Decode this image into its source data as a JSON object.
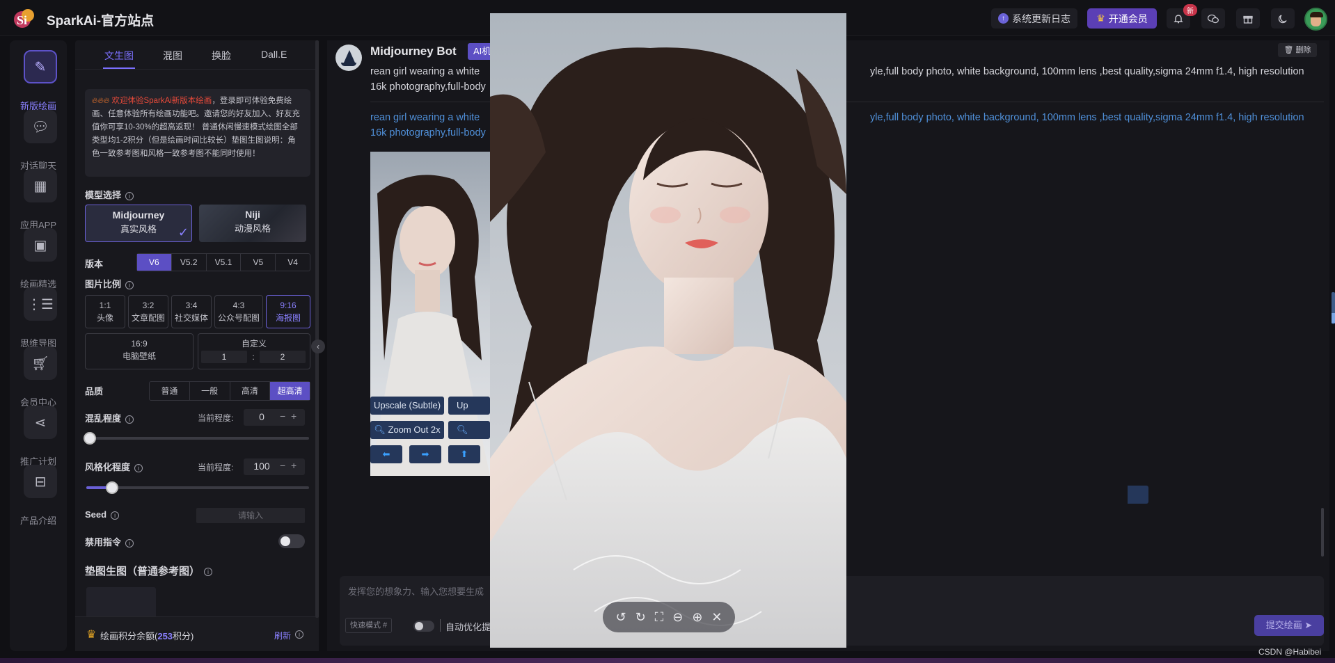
{
  "brand": {
    "name": "SparkAi-官方站点"
  },
  "topbar": {
    "update_log": "系统更新日志",
    "vip": "开通会员",
    "new_badge": "新"
  },
  "nav": [
    {
      "label": "新版绘画",
      "icon": "paint-brush-icon"
    },
    {
      "label": "对话聊天",
      "icon": "chat-bubble-icon"
    },
    {
      "label": "应用APP",
      "icon": "grid-apps-icon"
    },
    {
      "label": "绘画精选",
      "icon": "gallery-icon"
    },
    {
      "label": "思维导图",
      "icon": "mindmap-icon"
    },
    {
      "label": "会员中心",
      "icon": "cart-icon"
    },
    {
      "label": "推广计划",
      "icon": "share-icon"
    },
    {
      "label": "产品介绍",
      "icon": "product-box-icon"
    }
  ],
  "panel": {
    "tabs": [
      "文生图",
      "混图",
      "换脸",
      "Dall.E"
    ],
    "notice_hi": "欢迎体验SparkAi新版本绘画",
    "notice_rest": "，登录即可体验免费绘画、任意体验所有绘画功能吧。邀请您的好友加入、好友充值你可享10-30%的超高返现！ 普通休闲慢速模式绘图全部类型均1-2积分（但是绘画时间比较长）垫图生图说明：角色一致参考图和风格一致参考图不能同时使用！",
    "model_label": "模型选择",
    "models": [
      {
        "name": "Midjourney",
        "sub": "真实风格"
      },
      {
        "name": "Niji",
        "sub": "动漫风格"
      }
    ],
    "version_label": "版本",
    "versions": [
      "V6",
      "V5.2",
      "V5.1",
      "V5",
      "V4"
    ],
    "ratio_label": "图片比例",
    "ratios": [
      {
        "r": "1:1",
        "d": "头像"
      },
      {
        "r": "3:2",
        "d": "文章配图"
      },
      {
        "r": "3:4",
        "d": "社交媒体"
      },
      {
        "r": "4:3",
        "d": "公众号配图"
      },
      {
        "r": "9:16",
        "d": "海报图"
      },
      {
        "r": "16:9",
        "d": "电脑壁纸"
      }
    ],
    "custom_label": "自定义",
    "custom_w": "1",
    "custom_sep": ":",
    "custom_h": "2",
    "quality_label": "品质",
    "qualities": [
      "普通",
      "一般",
      "高清",
      "超高清"
    ],
    "chaos_label": "混乱程度",
    "current_label": "当前程度:",
    "chaos_value": "0",
    "chaos_fraction": 0,
    "stylize_label": "风格化程度",
    "stylize_value": "100",
    "stylize_fraction": 0.1,
    "seed_label": "Seed",
    "seed_placeholder": "请输入",
    "disable_label": "禁用指令",
    "pad_label": "垫图生图（普通参考图）",
    "credits_prefix": "绘画积分余额(",
    "credits_value": "253",
    "credits_suffix": "积分)",
    "refresh": "刷新"
  },
  "chat": {
    "bot_name": "Midjourney Bot",
    "badge": "AI机",
    "delete": "删除",
    "prompt_l1_left": "rean girl wearing a white",
    "prompt_l1_right": "yle,full body photo, white background, 100mm lens ,best quality,sigma 24mm f1.4, high resolution",
    "prompt_l2": "16k photography,full-body",
    "buttons_row1": [
      "Upscale (Subtle)",
      "Up"
    ],
    "buttons_row2": [
      "Zoom Out 2x",
      ""
    ],
    "arrows": [
      "⬅",
      "➡",
      "⬆"
    ],
    "input_placeholder": "发挥您的想象力、输入您想要生成",
    "mode_tag": "快速模式 #",
    "auto_label": "自动优化提",
    "submit": "提交绘画"
  },
  "viewer": {
    "tools": [
      "rotate-left-icon",
      "rotate-right-icon",
      "fit-screen-icon",
      "zoom-out-icon",
      "zoom-in-icon",
      "close-icon"
    ]
  },
  "watermark": "CSDN @Habibei",
  "colors": {
    "accent": "#5c4fc4",
    "link": "#4f8fd8",
    "vip": "#5b3fb5",
    "alert": "#e84a3a"
  }
}
